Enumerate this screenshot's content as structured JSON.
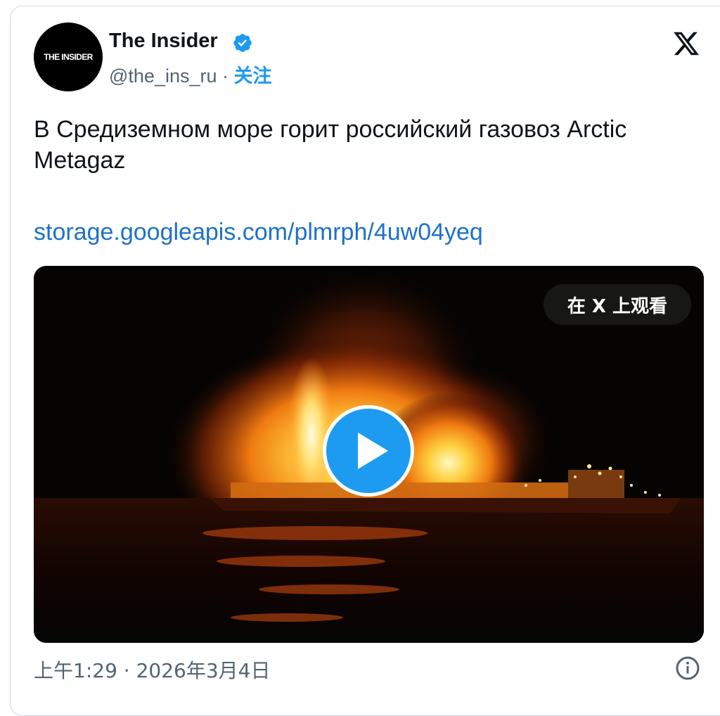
{
  "author": {
    "avatar_text": "THE INSIDER",
    "name": "The Insider",
    "verified": true,
    "handle": "@the_ins_ru",
    "separator": "·",
    "follow_label": "关注"
  },
  "platform_icon": "x-logo-icon",
  "tweet": {
    "text": "В Средиземном море горит российский газовоз Arctic Metagaz",
    "link": "storage.googleapis.com/plmrph/4uw04yeq"
  },
  "media": {
    "type": "video",
    "watch_label": "在 X 上观看",
    "play_icon": "play-icon"
  },
  "footer": {
    "timestamp": "上午1:29 · 2026年3月4日",
    "info_icon": "info-icon"
  },
  "colors": {
    "accent": "#1d9bf0",
    "link": "#1d71c9",
    "text": "#0f1419",
    "muted": "#536471",
    "border": "#cfd9de"
  }
}
